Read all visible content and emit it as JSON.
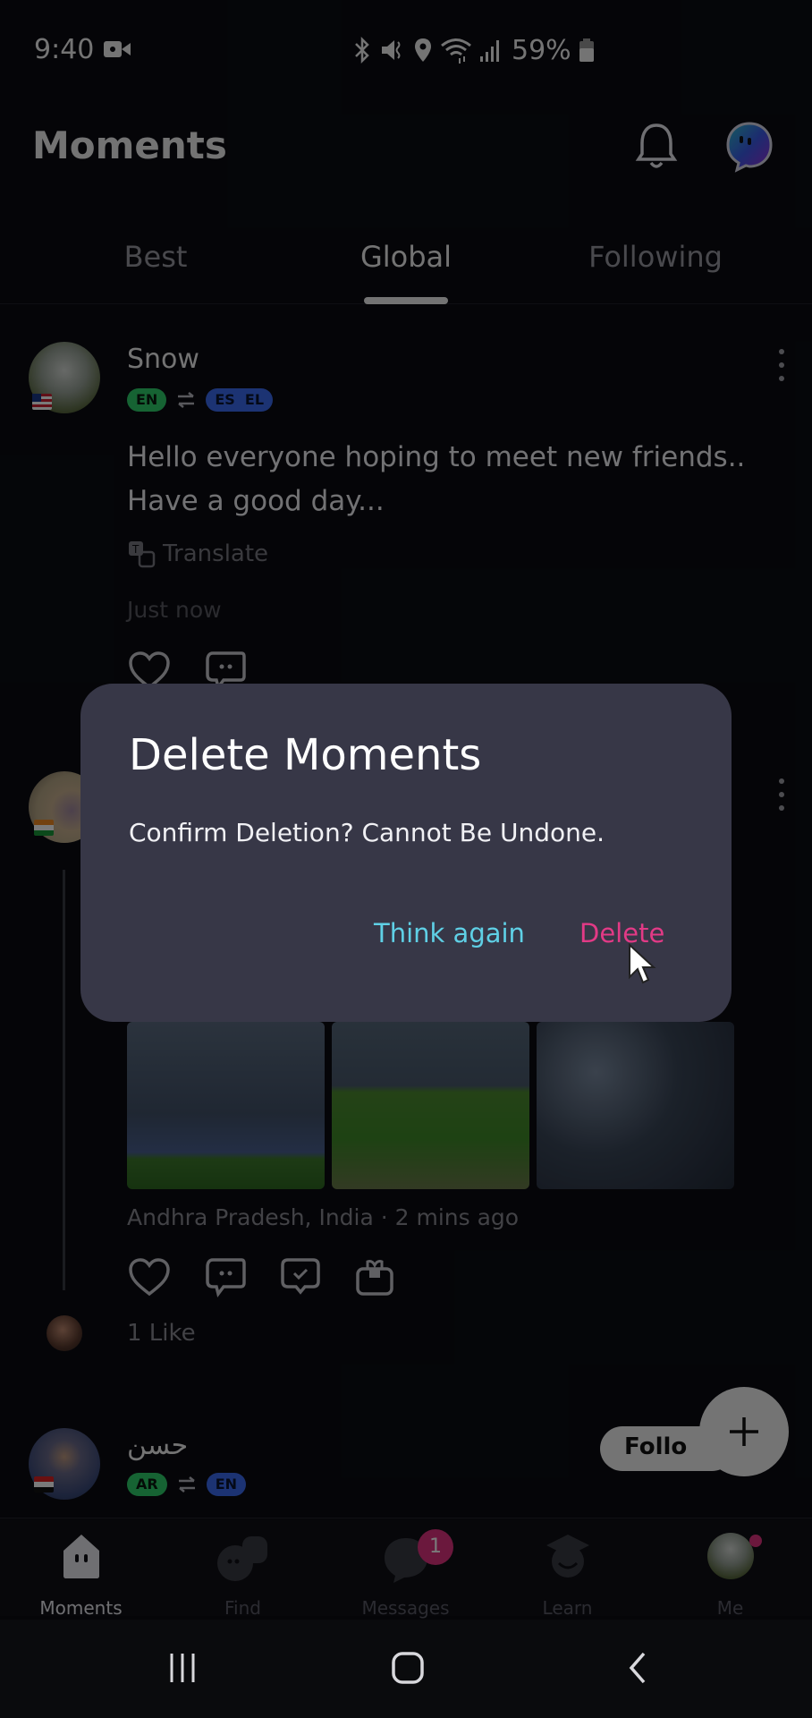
{
  "status_bar": {
    "time": "9:40",
    "battery_percent": "59%",
    "icons": [
      "video-record-icon",
      "bluetooth-icon",
      "vibrate-mute-icon",
      "location-icon",
      "wifi-icon",
      "signal-icon",
      "battery-icon"
    ]
  },
  "app_bar": {
    "title": "Moments",
    "icons": [
      "bell-icon",
      "brand-chat-icon"
    ]
  },
  "tabs": {
    "items": [
      {
        "label": "Best",
        "active": false
      },
      {
        "label": "Global",
        "active": true
      },
      {
        "label": "Following",
        "active": false
      }
    ]
  },
  "feed": {
    "posts": [
      {
        "username": "Snow",
        "flag": "US",
        "native_langs": [
          "EN"
        ],
        "learning_langs": [
          "ES",
          "EL"
        ],
        "text_line1": "Hello everyone hoping to meet new friends..",
        "text_line2": "Have a good day...",
        "translate_label": "Translate",
        "timestamp": "Just now"
      },
      {
        "flag": "IN",
        "location_time": "Andhra Pradesh, India · 2 mins ago",
        "likes": "1 Like",
        "photo_count": 3
      },
      {
        "username": "حسن",
        "flag": "EG",
        "native_langs": [
          "AR"
        ],
        "learning_langs": [
          "EN"
        ],
        "follow_label": "Follo"
      }
    ]
  },
  "fab": {
    "icon": "plus-icon"
  },
  "bottom_nav": {
    "items": [
      {
        "label": "Moments",
        "active": true
      },
      {
        "label": "Find",
        "active": false
      },
      {
        "label": "Messages",
        "active": false,
        "badge": "1"
      },
      {
        "label": "Learn",
        "active": false
      },
      {
        "label": "Me",
        "active": false,
        "dot": true
      }
    ]
  },
  "dialog": {
    "title": "Delete Moments",
    "message": "Confirm Deletion? Cannot Be Undone.",
    "cancel_label": "Think again",
    "confirm_label": "Delete"
  },
  "colors": {
    "dialog_bg": "#373747",
    "cancel": "#5fd0e6",
    "delete": "#e23a86",
    "badge": "#e0337f",
    "lang_native": "#2fcf6c",
    "lang_learning": "#3c6cf0"
  }
}
